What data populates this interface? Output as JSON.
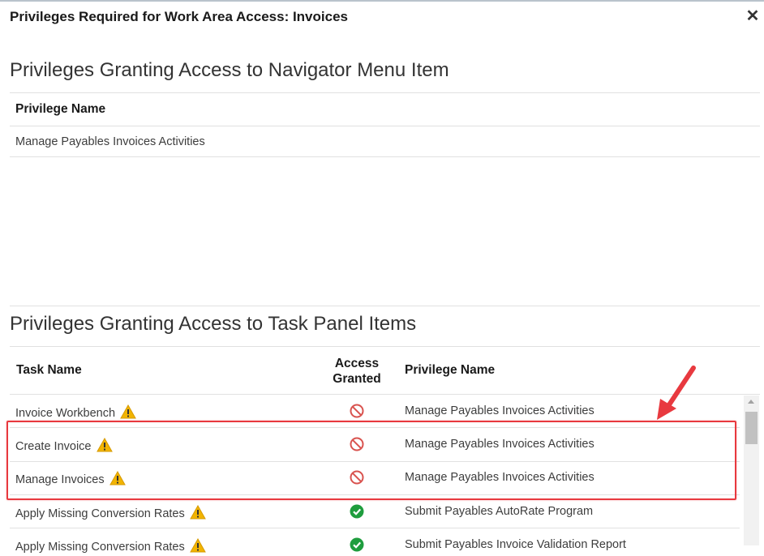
{
  "dialog": {
    "title": "Privileges Required for Work Area Access: Invoices",
    "close_glyph": "✕"
  },
  "navigator_section": {
    "heading": "Privileges Granting Access to Navigator Menu Item",
    "column_header": "Privilege Name",
    "rows": [
      "Manage Payables Invoices Activities"
    ]
  },
  "task_panel_section": {
    "heading": "Privileges Granting Access to Task Panel Items",
    "headers": {
      "task_name": "Task Name",
      "access_granted_line1": "Access",
      "access_granted_line2": "Granted",
      "privilege_name": "Privilege Name"
    },
    "rows": [
      {
        "task": "Invoice Workbench",
        "warning": true,
        "access": "denied",
        "privilege": "Manage Payables Invoices Activities"
      },
      {
        "task": "Create Invoice",
        "warning": true,
        "access": "denied",
        "privilege": "Manage Payables Invoices Activities"
      },
      {
        "task": "Manage Invoices",
        "warning": true,
        "access": "denied",
        "privilege": "Manage Payables Invoices Activities"
      },
      {
        "task": "Apply Missing Conversion Rates",
        "warning": true,
        "access": "granted",
        "privilege": "Submit Payables AutoRate Program"
      },
      {
        "task": "Apply Missing Conversion Rates",
        "warning": true,
        "access": "granted",
        "privilege": "Submit Payables Invoice Validation Report"
      }
    ]
  },
  "icons": {
    "warning": "warning-triangle-icon",
    "denied": "no-entry-icon",
    "granted": "check-circle-icon"
  },
  "colors": {
    "warning": "#e8a400",
    "denied": "#d9534f",
    "granted": "#1f9d3e",
    "highlight": "#e8393f"
  }
}
